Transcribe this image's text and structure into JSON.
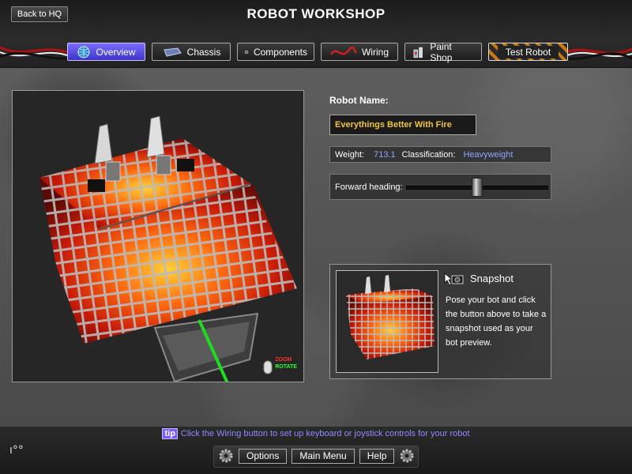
{
  "header": {
    "back_label": "Back to HQ",
    "title": "ROBOT WORKSHOP"
  },
  "tabs": [
    {
      "label": "Overview",
      "icon": "globe-icon",
      "active": true
    },
    {
      "label": "Chassis",
      "icon": "chassis-icon",
      "active": false
    },
    {
      "label": "Components",
      "icon": "gear-icon",
      "active": false
    },
    {
      "label": "Wiring",
      "icon": "wire-icon",
      "active": false
    },
    {
      "label": "Paint Shop",
      "icon": "paint-can-icon",
      "active": false
    },
    {
      "label": "Test Robot",
      "icon": "",
      "active": false
    }
  ],
  "viewport": {
    "legend_zoom": "ZOOM",
    "legend_rotate": "ROTATE"
  },
  "robot": {
    "name_label": "Robot Name:",
    "name_value": "Everythings Better With Fire",
    "weight_label": "Weight:",
    "weight_value": "713.1",
    "class_label": "Classification:",
    "class_value": "Heavyweight",
    "heading_label": "Forward heading:",
    "heading_slider_fraction": 0.5
  },
  "snapshot": {
    "title": "Snapshot",
    "description": "Pose your bot and click the button above to take a snapshot used as your bot preview."
  },
  "footer": {
    "tip_badge": "tip",
    "tip_text": "Click the Wiring button to set up keyboard or joystick controls for your robot",
    "options_label": "Options",
    "main_menu_label": "Main Menu",
    "help_label": "Help"
  },
  "colors": {
    "accent": "#7b5cff",
    "name_text": "#f2c33a",
    "value_text": "#8fa6ff",
    "tip_text": "#8a8cff"
  }
}
